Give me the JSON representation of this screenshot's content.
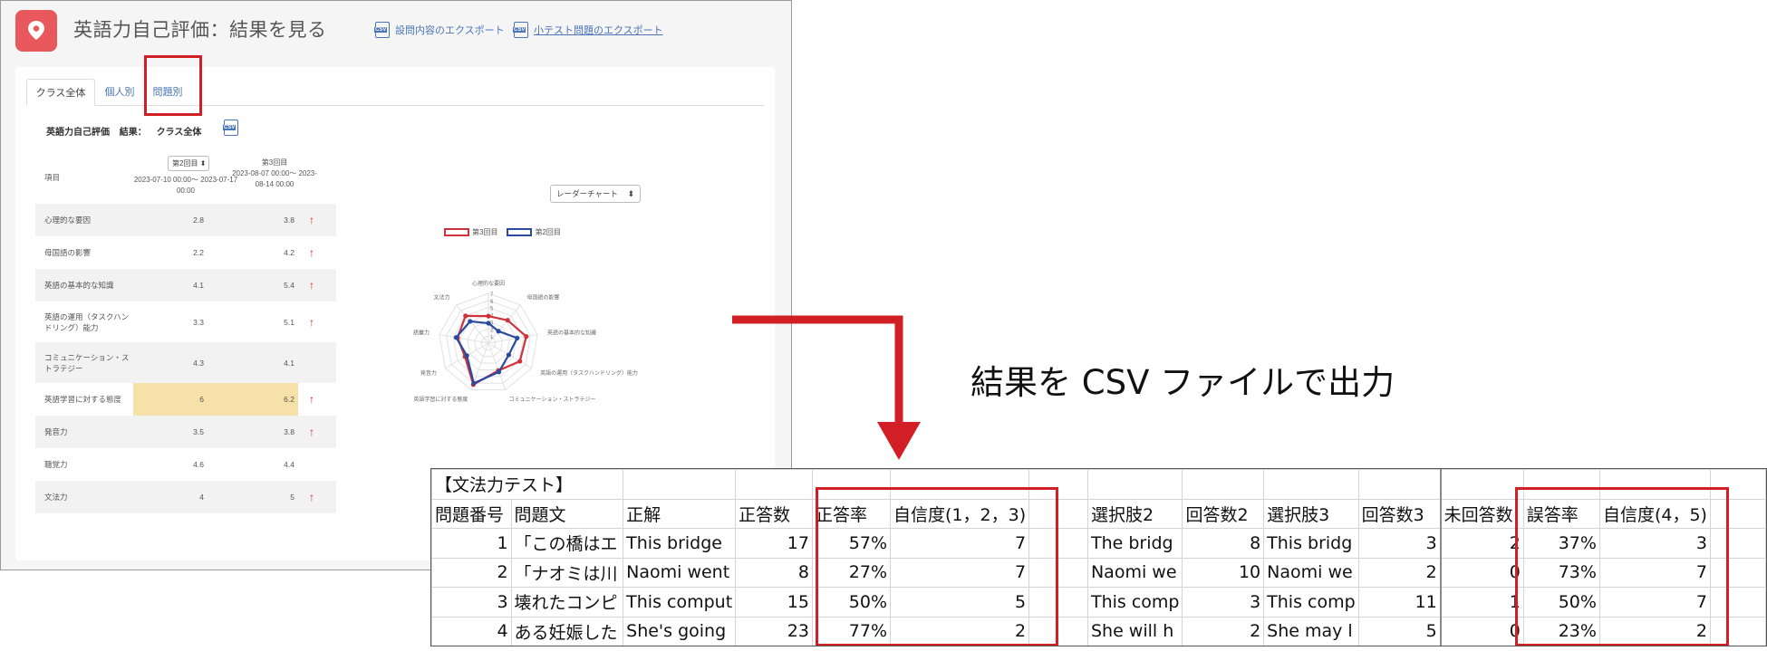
{
  "app": {
    "title": "英語力自己評価：結果を見る",
    "export_survey_label": "設問内容のエクスポート",
    "export_quiz_label": "小テスト問題のエクスポート",
    "tabs": [
      {
        "label": "クラス全体"
      },
      {
        "label": "個人別"
      },
      {
        "label": "問題別"
      }
    ],
    "result_heading": {
      "name": "英語力自己評価",
      "result_label": "結果：",
      "scope": "クラス全体"
    },
    "table": {
      "item_header": "項目",
      "round_select": "第2回目",
      "col1_dates": "2023-07-10 00:00～ 2023-07-17 00:00",
      "col2_title": "第3回目",
      "col2_dates": "2023-08-07 00:00～ 2023-08-14 00:00",
      "rows": [
        {
          "label": "心理的な要因",
          "v1": "2.8",
          "v2": "3.8",
          "up": "↑"
        },
        {
          "label": "母国語の影響",
          "v1": "2.2",
          "v2": "4.2",
          "up": "↑"
        },
        {
          "label": "英語の基本的な知識",
          "v1": "4.1",
          "v2": "5.4",
          "up": "↑"
        },
        {
          "label": "英語の運用（タスクハンドリング）能力",
          "v1": "3.3",
          "v2": "5.1",
          "up": "↑"
        },
        {
          "label": "コミュニケーション・ストラテジー",
          "v1": "4.3",
          "v2": "4.1",
          "up": ""
        },
        {
          "label": "英語学習に対する態度",
          "v1": "6",
          "v2": "6.2",
          "up": "↑"
        },
        {
          "label": "発音力",
          "v1": "3.5",
          "v2": "3.8",
          "up": "↑"
        },
        {
          "label": "聴覚力",
          "v1": "4.6",
          "v2": "4.4",
          "up": ""
        },
        {
          "label": "文法力",
          "v1": "4",
          "v2": "5",
          "up": "↑"
        }
      ]
    },
    "chart_select": "レーダーチャート",
    "chart_data": {
      "type": "radar",
      "categories": [
        "心理的な要因",
        "母国語の影響",
        "英語の基本的な知識",
        "英語の運用（タスクハンドリング）能力",
        "コミュニケーション・ストラテジー",
        "英語学習に対する態度",
        "発音力",
        "語彙力",
        "文法力"
      ],
      "axis_ticks": [
        "1",
        "2",
        "3",
        "4",
        "5",
        "6",
        "7"
      ],
      "rlim": [
        0,
        7
      ],
      "series": [
        {
          "name": "第3回目",
          "color": "#d0313a",
          "values": [
            3.8,
            4.2,
            5.4,
            5.1,
            4.1,
            6.2,
            3.8,
            4.4,
            5
          ]
        },
        {
          "name": "第2回目",
          "color": "#2a4aa0",
          "values": [
            2.8,
            2.2,
            4.1,
            3.3,
            4.3,
            6,
            3.5,
            4.6,
            4
          ]
        }
      ],
      "legend_position": "top"
    }
  },
  "caption": "結果を CSV ファイルで出力",
  "sheet": {
    "title": "【文法力テスト】",
    "headers": [
      "問題番号",
      "問題文",
      "正解",
      "正答数",
      "正答率",
      "自信度(1，2，3)",
      "",
      "選択肢2",
      "回答数2",
      "選択肢3",
      "回答数3",
      "未回答数",
      "誤答率",
      "自信度(4，5)",
      ""
    ],
    "rows": [
      [
        "1",
        "「この橋はエ",
        "This bridge",
        "17",
        "57%",
        "7",
        "",
        "The bridg",
        "8",
        "This bridg",
        "3",
        "2",
        "37%",
        "3",
        ""
      ],
      [
        "2",
        "「ナオミは川",
        "Naomi went",
        "8",
        "27%",
        "7",
        "",
        "Naomi we",
        "10",
        "Naomi we",
        "2",
        "0",
        "73%",
        "7",
        ""
      ],
      [
        "3",
        "壊れたコンピ",
        "This comput",
        "15",
        "50%",
        "5",
        "",
        "This comp",
        "3",
        "This comp",
        "11",
        "1",
        "50%",
        "7",
        ""
      ],
      [
        "4",
        "ある妊娠した",
        "She's going",
        "23",
        "77%",
        "2",
        "",
        "She will h",
        "2",
        "She may l",
        "5",
        "0",
        "23%",
        "2",
        ""
      ]
    ]
  },
  "colors": {
    "accent_red": "#d21f26",
    "link_blue": "#4a74b8",
    "highlight": "#f6e2a8",
    "logo": "#e8585c"
  }
}
